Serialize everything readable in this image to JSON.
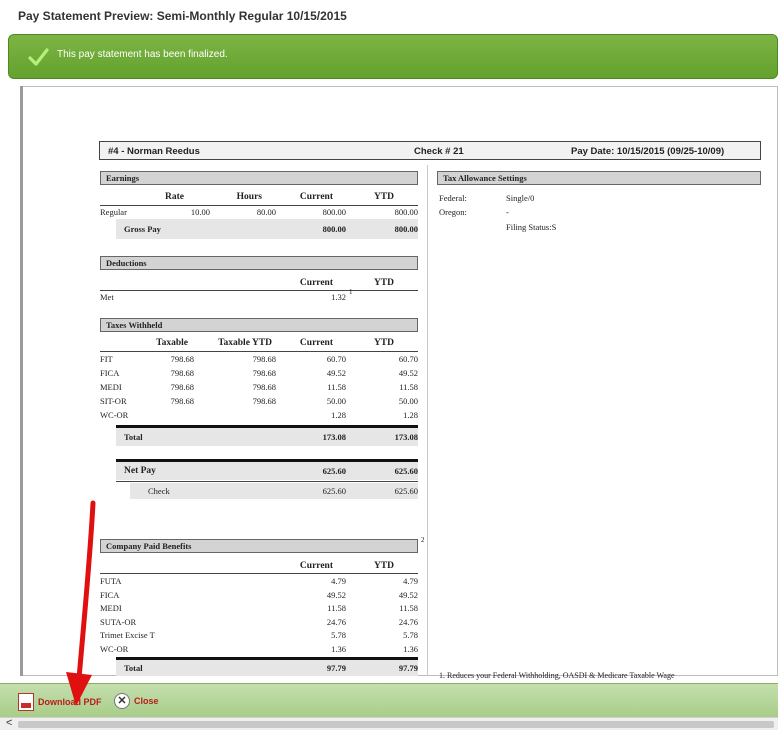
{
  "page_title": "Pay Statement Preview: Semi-Monthly Regular 10/15/2015",
  "banner": {
    "message": "This pay statement has been finalized."
  },
  "statement": {
    "employee": "#4 - Norman Reedus",
    "check": "Check # 21",
    "pay_date": "Pay Date: 10/15/2015 (09/25-10/09)",
    "earnings": {
      "title": "Earnings",
      "headers": [
        "Rate",
        "Hours",
        "Current",
        "YTD"
      ],
      "rows": [
        {
          "label": "Regular",
          "rate": "10.00",
          "hours": "80.00",
          "current": "800.00",
          "ytd": "800.00"
        }
      ],
      "gross": {
        "label": "Gross Pay",
        "current": "800.00",
        "ytd": "800.00"
      }
    },
    "deductions": {
      "title": "Deductions",
      "headers": [
        "Current",
        "YTD"
      ],
      "rows": [
        {
          "label": "Met",
          "current": "1.32",
          "note": "1"
        }
      ]
    },
    "taxes": {
      "title": "Taxes Withheld",
      "headers": [
        "Taxable",
        "Taxable YTD",
        "Current",
        "YTD"
      ],
      "rows": [
        {
          "label": "FIT",
          "taxable": "798.68",
          "taxable_ytd": "798.68",
          "current": "60.70",
          "ytd": "60.70"
        },
        {
          "label": "FICA",
          "taxable": "798.68",
          "taxable_ytd": "798.68",
          "current": "49.52",
          "ytd": "49.52"
        },
        {
          "label": "MEDI",
          "taxable": "798.68",
          "taxable_ytd": "798.68",
          "current": "11.58",
          "ytd": "11.58"
        },
        {
          "label": "SIT-OR",
          "taxable": "798.68",
          "taxable_ytd": "798.68",
          "current": "50.00",
          "ytd": "50.00"
        },
        {
          "label": "WC-OR",
          "taxable": "",
          "taxable_ytd": "",
          "current": "1.28",
          "ytd": "1.28"
        }
      ],
      "total": {
        "label": "Total",
        "current": "173.08",
        "ytd": "173.08"
      }
    },
    "net_pay": {
      "label": "Net Pay",
      "current": "625.60",
      "ytd": "625.60",
      "check_label": "Check",
      "check_current": "625.60",
      "check_ytd": "625.60"
    },
    "benefits": {
      "title": "Company Paid Benefits",
      "note": "2",
      "headers": [
        "Current",
        "YTD"
      ],
      "rows": [
        {
          "label": "FUTA",
          "current": "4.79",
          "ytd": "4.79"
        },
        {
          "label": "FICA",
          "current": "49.52",
          "ytd": "49.52"
        },
        {
          "label": "MEDI",
          "current": "11.58",
          "ytd": "11.58"
        },
        {
          "label": "SUTA-OR",
          "current": "24.76",
          "ytd": "24.76"
        },
        {
          "label": "Trimet Excise T",
          "current": "5.78",
          "ytd": "5.78"
        },
        {
          "label": "WC-OR",
          "current": "1.36",
          "ytd": "1.36"
        }
      ],
      "total": {
        "label": "Total",
        "current": "97.79",
        "ytd": "97.79"
      }
    },
    "tax_allowance": {
      "title": "Tax Allowance Settings",
      "federal_label": "Federal:",
      "federal_value": "Single/0",
      "oregon_label": "Oregon:",
      "oregon_value": "-",
      "filing_status": "Filing Status:S"
    },
    "footnote": "1. Reduces your Federal Withholding, OASDI & Medicare Taxable Wage"
  },
  "toolbar": {
    "download_label": "Download PDF",
    "close_label": "Close"
  },
  "colors": {
    "banner": "#6aa535",
    "toolbar": "#b5d69a",
    "annotation_arrow": "#e01010"
  }
}
